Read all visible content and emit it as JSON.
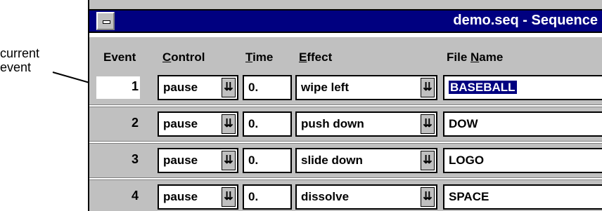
{
  "callout": {
    "line1": "current",
    "line2": "event"
  },
  "window": {
    "title": "demo.seq - Sequence"
  },
  "columns": {
    "event": "Event",
    "control": "Control",
    "time": "Time",
    "effect": "Effect",
    "filename": "File Name"
  },
  "rows": [
    {
      "event": "1",
      "control": "pause",
      "time": "0.",
      "effect": "wipe left",
      "filename": "BASEBALL",
      "selected": true
    },
    {
      "event": "2",
      "control": "pause",
      "time": "0.",
      "effect": "push down",
      "filename": "DOW"
    },
    {
      "event": "3",
      "control": "pause",
      "time": "0.",
      "effect": "slide down",
      "filename": "LOGO"
    },
    {
      "event": "4",
      "control": "pause",
      "time": "0.",
      "effect": "dissolve",
      "filename": "SPACE"
    }
  ],
  "icons": {
    "dropdown": "dropdown-arrow-icon",
    "system_menu": "system-menu-icon"
  }
}
